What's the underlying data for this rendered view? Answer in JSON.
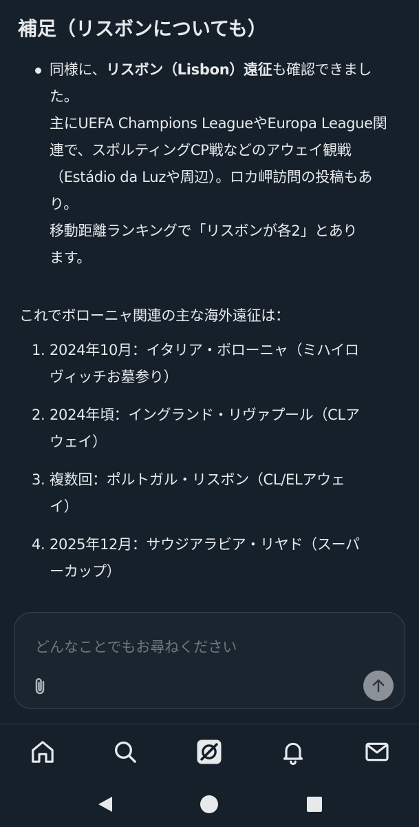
{
  "heading": "補足（リスボンについても）",
  "bullet": {
    "lines": [
      {
        "pre": "同様に、",
        "bold1": "リスボン（Lisbon）遠征",
        "post": "も確認できまし"
      },
      {
        "text": "た。"
      },
      {
        "text": "主にUEFA Champions LeagueやEuropa League関"
      },
      {
        "text": "連で、スポルティングCP戦などのアウェイ観戦"
      },
      {
        "text": "（Estádio da Luzや周辺）。ロカ岬訪問の投稿もあ"
      },
      {
        "text": "り。"
      },
      {
        "text": "移動距離ランキングで「リスボンが各2」とあり"
      },
      {
        "text": "ます。"
      }
    ]
  },
  "intro": "これでボローニャ関連の主な海外遠征は：",
  "list": [
    {
      "num": "1.",
      "line1": "2024年10月：イタリア・ボローニャ（ミハイロ",
      "line2": "ヴィッチお墓参り）"
    },
    {
      "num": "2.",
      "line1": "2024年頃：イングランド・リヴァプール（CLア",
      "line2": "ウェイ）"
    },
    {
      "num": "3.",
      "line1": "複数回：ポルトガル・リスボン（CL/ELアウェ",
      "line2": "イ）"
    },
    {
      "num": "4.",
      "line1": "2025年12月：サウジアラビア・リヤド（スーパ",
      "line2": "ーカップ）"
    }
  ],
  "composer": {
    "placeholder": "どんなことでもお尋ねください",
    "value": ""
  },
  "icons": {
    "attach": "paperclip-icon",
    "send": "arrow-up-icon",
    "nav": [
      "home-icon",
      "search-icon",
      "grok-icon",
      "bell-icon",
      "mail-icon"
    ],
    "system": [
      "back-icon",
      "home-circle-icon",
      "recents-icon"
    ]
  },
  "colors": {
    "background": "#15202b",
    "text": "#e7e9ea",
    "placeholder": "#71767b",
    "send_button": "#8b9196"
  }
}
